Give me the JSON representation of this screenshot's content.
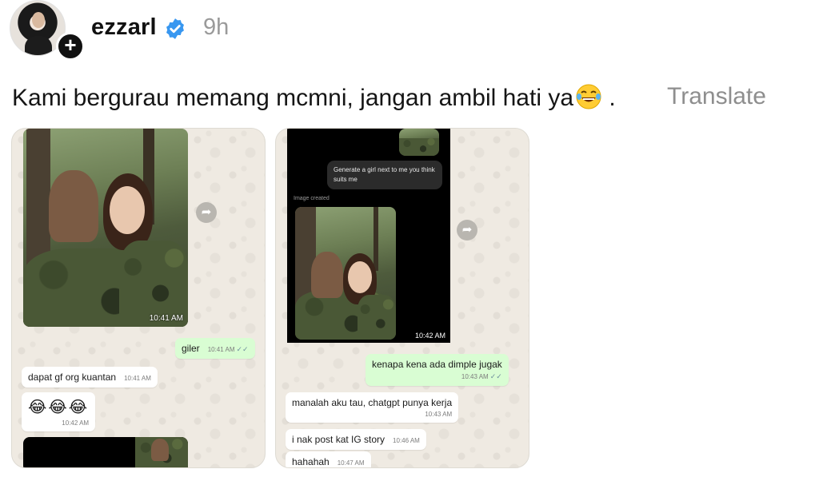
{
  "post": {
    "username": "ezzarl",
    "time_ago": "9h",
    "caption": "Kami bergurau memang mcmni, jangan ambil hati ya",
    "caption_suffix": " .",
    "translate_label": "Translate"
  },
  "card1": {
    "photo_time": "10:41 AM",
    "messages": [
      {
        "text": "giler",
        "time": "10:41 AM",
        "direction": "out"
      },
      {
        "text": "dapat gf org kuantan",
        "time": "10:41 AM",
        "direction": "in"
      },
      {
        "text": "😂😂😂",
        "time": "10:42 AM",
        "direction": "in"
      }
    ]
  },
  "card2": {
    "prompt_text": "Generate a girl next to me you think suits me",
    "image_label": "Image created",
    "photo_time": "10:42 AM",
    "messages": [
      {
        "text": "kenapa kena ada dimple jugak",
        "time": "10:43 AM",
        "direction": "out"
      },
      {
        "text": "manalah aku tau, chatgpt punya kerja",
        "time": "10:43 AM",
        "direction": "in"
      },
      {
        "text": "i nak post kat IG story",
        "time": "10:46 AM",
        "direction": "in"
      },
      {
        "text": "hahahah",
        "time": "10:47 AM",
        "direction": "in"
      }
    ]
  },
  "icons": {
    "verified": "verified-badge-icon",
    "follow": "plus-icon",
    "forward": "forward-arrow-icon",
    "read": "double-check-icon"
  },
  "colors": {
    "verified_blue": "#3897f0",
    "outgoing_bubble": "#d9fdd3",
    "chat_background": "#efeae2"
  }
}
